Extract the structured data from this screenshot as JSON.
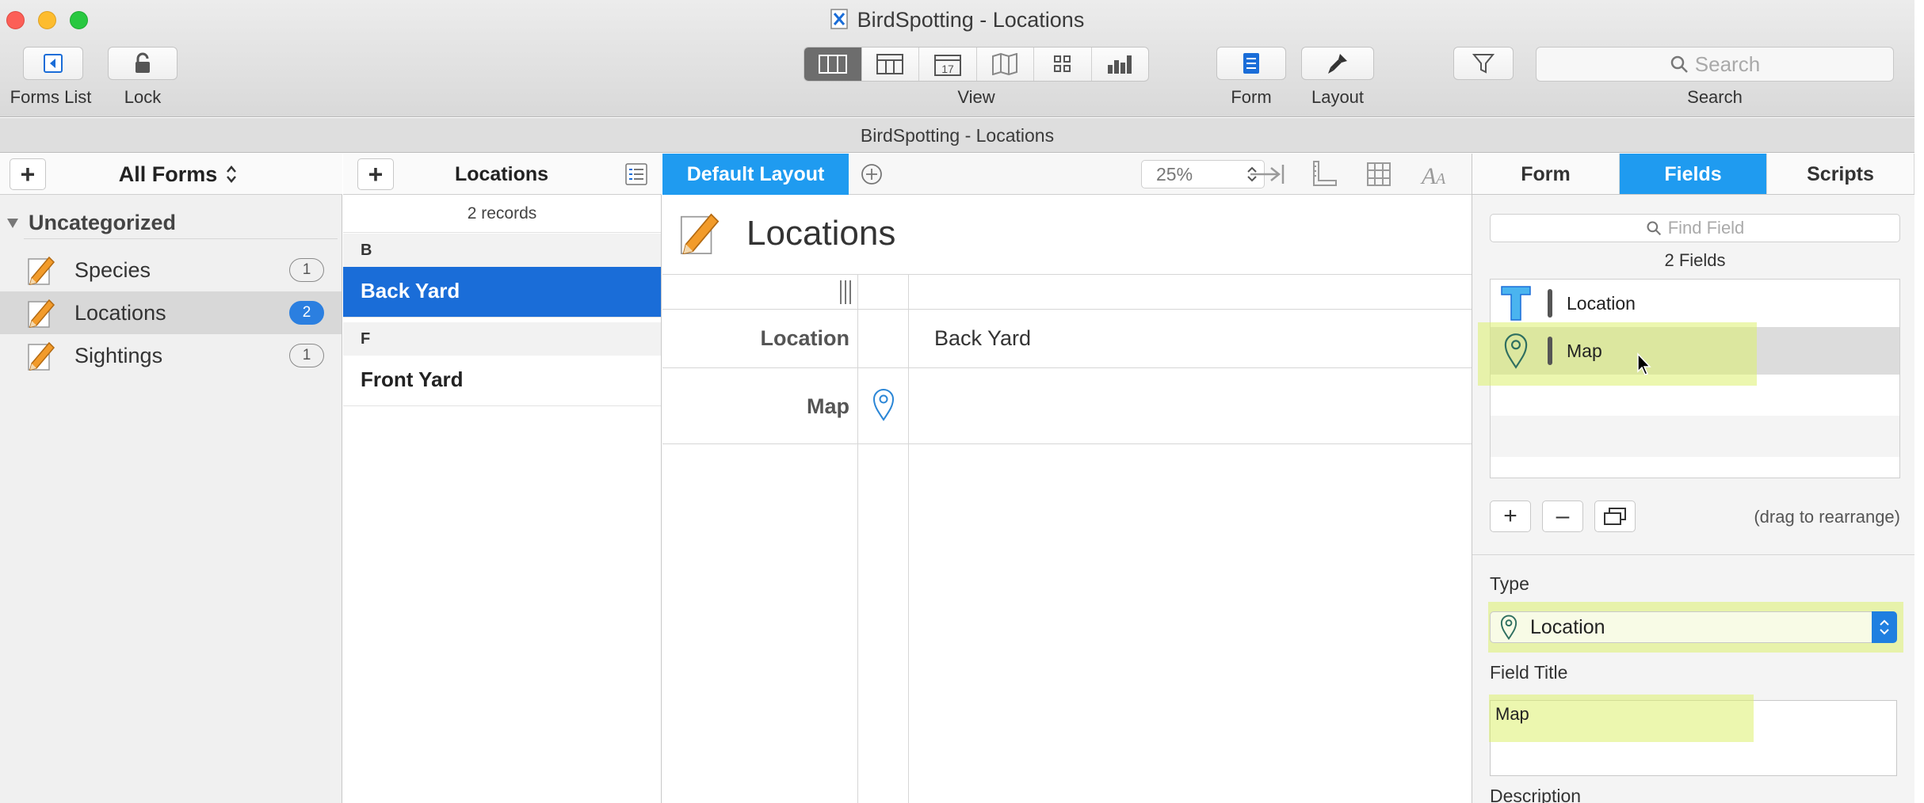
{
  "window": {
    "title": "BirdSpotting - Locations",
    "subtitle": "BirdSpotting - Locations"
  },
  "toolbar": {
    "forms_list_label": "Forms List",
    "lock_label": "Lock",
    "view_label": "View",
    "form_label": "Form",
    "layout_label": "Layout",
    "search_label": "Search",
    "search_placeholder": "Search",
    "view_modes": [
      "columns-icon",
      "card-icon",
      "calendar-icon",
      "map-icon",
      "grid-icon",
      "chart-icon"
    ],
    "active_view_index": 0
  },
  "sidebar": {
    "header_title": "All Forms",
    "section_title": "Uncategorized",
    "forms": [
      {
        "label": "Species",
        "count": "1"
      },
      {
        "label": "Locations",
        "count": "2",
        "selected": true
      },
      {
        "label": "Sightings",
        "count": "1"
      }
    ]
  },
  "records": {
    "header_title": "Locations",
    "record_count": "2 records",
    "sections": [
      {
        "letter": "B",
        "rows": [
          "Back Yard"
        ]
      },
      {
        "letter": "F",
        "rows": [
          "Front Yard"
        ]
      }
    ],
    "selected_row": "Back Yard"
  },
  "canvas": {
    "layout_tab": "Default Layout",
    "zoom": "25%",
    "form_title": "Locations",
    "fields": [
      {
        "label": "Location",
        "value": "Back Yard"
      },
      {
        "label": "Map",
        "value": ""
      }
    ]
  },
  "inspector": {
    "tabs": [
      "Form",
      "Fields",
      "Scripts"
    ],
    "active_tab": "Fields",
    "find_placeholder": "Find Field",
    "fields_count": "2 Fields",
    "fields": [
      {
        "name": "Location",
        "icon": "text-field-icon"
      },
      {
        "name": "Map",
        "icon": "location-pin-icon",
        "selected": true
      }
    ],
    "drag_hint": "(drag to rearrange)",
    "type_label": "Type",
    "type_value": "Location",
    "field_title_label": "Field Title",
    "field_title_value": "Map",
    "description_label": "Description"
  },
  "colors": {
    "accent_blue": "#1f9bf0",
    "selection_blue": "#1a6dd8",
    "highlight_yellow": "#e6f2a0"
  }
}
